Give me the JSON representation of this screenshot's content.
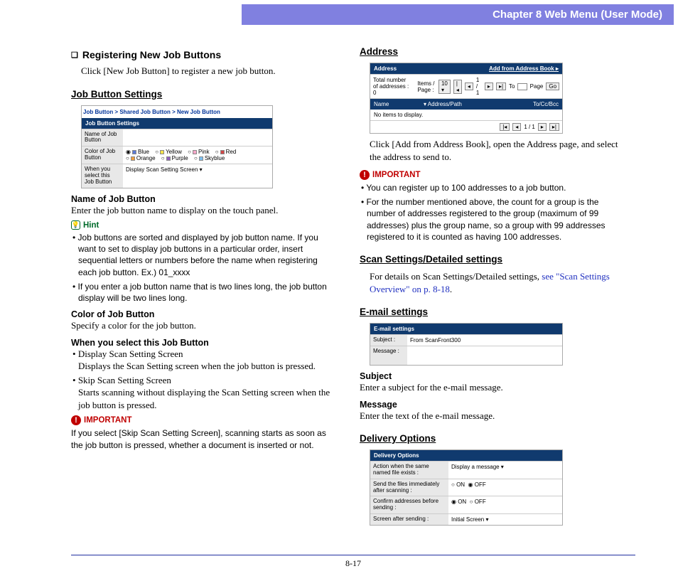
{
  "header": {
    "chapter": "Chapter 8   Web Menu (User Mode)"
  },
  "footer": {
    "page": "8-17"
  },
  "left": {
    "reg_title": "Registering New Job Buttons",
    "reg_text": "Click [New Job Button] to register a new job button.",
    "jbs_heading": "Job Button Settings",
    "jbs_screenshot": {
      "breadcrumb": "Job Button > Shared Job Button > New Job Button",
      "bar": "Job Button Settings",
      "rows": {
        "name_lbl": "Name of Job Button",
        "color_lbl": "Color of Job Button",
        "when_lbl": "When you select this Job Button",
        "when_val": "Display Scan Setting Screen ▾",
        "colors": {
          "c1": "Blue",
          "c2": "Yellow",
          "c3": "Pink",
          "c4": "Red",
          "c5": "Orange",
          "c6": "Purple",
          "c7": "Skyblue"
        }
      }
    },
    "name_head": "Name of Job Button",
    "name_text": "Enter the job button name to display on the touch panel.",
    "hint_label": "Hint",
    "hint_items": {
      "h1": "Job buttons are sorted and displayed by job button name. If you want to set to display job buttons in a particular order, insert sequential letters or numbers before the name when registering each job button. Ex.) 01_xxxx",
      "h2": "If you enter a job button name that is two lines long, the job button display will be two lines long."
    },
    "color_head": "Color of Job Button",
    "color_text": "Specify a color for the job button.",
    "when_head": "When you select this Job Button",
    "when_items": {
      "w1h": "Display Scan Setting Screen",
      "w1b": "Displays the Scan Setting screen when the job button is pressed.",
      "w2h": "Skip Scan Setting Screen",
      "w2b": "Starts scanning without displaying the Scan Setting screen when the job button is pressed."
    },
    "important_label": "IMPORTANT",
    "important_text": "If you select [Skip Scan Setting Screen], scanning starts as soon as the job button is pressed, whether a document is inserted or not."
  },
  "right": {
    "addr_heading": "Address",
    "addr_screenshot": {
      "bar": "Address",
      "add_link": "Add from Address Book ▸",
      "toolbar": {
        "total": "Total number of addresses : 0",
        "ipp": "Items / Page :",
        "ipp_val": "10  ▾",
        "pager": "1 / 1",
        "to": "To",
        "page": "Page",
        "go": "Go"
      },
      "head": {
        "c1": "Name",
        "c2": "▾  Address/Path",
        "c3": "To/Cc/Bcc"
      },
      "empty": "No items to display.",
      "footer_pager": "1 / 1"
    },
    "addr_text": "Click [Add from Address Book], open the Address page, and select the address to send to.",
    "imp_label": "IMPORTANT",
    "imp_items": {
      "i1": "You can register up to 100 addresses to a job button.",
      "i2": "For the number mentioned above, the count for a group is the number of addresses registered to the group (maximum of 99 addresses) plus the group name, so a group with 99 addresses registered to it is counted as having 100 addresses."
    },
    "scan_heading": "Scan Settings/Detailed settings",
    "scan_text_a": "For details on Scan Settings/Detailed settings, ",
    "scan_link": "see \"Scan Settings Overview\" on p. 8-18",
    "scan_text_b": ".",
    "email_heading": "E-mail settings",
    "email_screenshot": {
      "bar": "E-mail settings",
      "subj_lbl": "Subject :",
      "subj_val": "From ScanFront300",
      "msg_lbl": "Message :"
    },
    "subj_head": "Subject",
    "subj_text": "Enter a subject for the e-mail message.",
    "msg_head": "Message",
    "msg_text": "Enter the text of the e-mail message.",
    "do_heading": "Delivery Options",
    "do_screenshot": {
      "bar": "Delivery Options",
      "r1l": "Action when the same named file exists :",
      "r1v": "Display a message  ▾",
      "r2l": "Send the files immediately after scanning :",
      "r2v_on": "ON",
      "r2v_off": "OFF",
      "r3l": "Confirm addresses before sending :",
      "r4l": "Screen after sending :",
      "r4v": "Initial Screen             ▾"
    }
  }
}
